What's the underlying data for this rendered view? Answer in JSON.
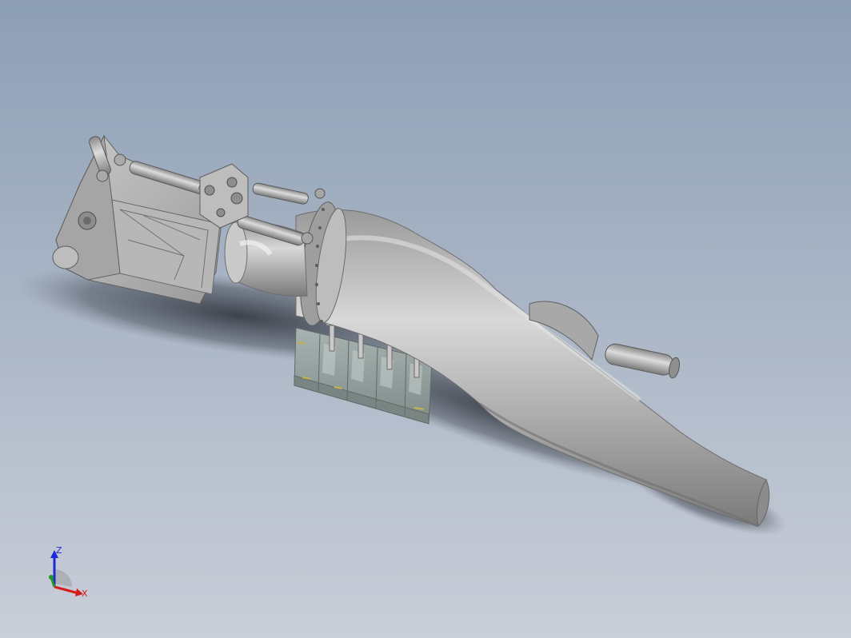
{
  "viewport": {
    "background_top": "#8d9fb5",
    "background_bottom": "#c9ced8"
  },
  "model": {
    "body_color": "#a9a9a9",
    "pedestal_color": "#96a3a1",
    "accent_color": "#c8b24a"
  },
  "triad": {
    "z_label": "Z",
    "x_label": "X",
    "z_color": "#1b2bd6",
    "x_color": "#d61b1b",
    "y_color": "#1e9a1e"
  }
}
